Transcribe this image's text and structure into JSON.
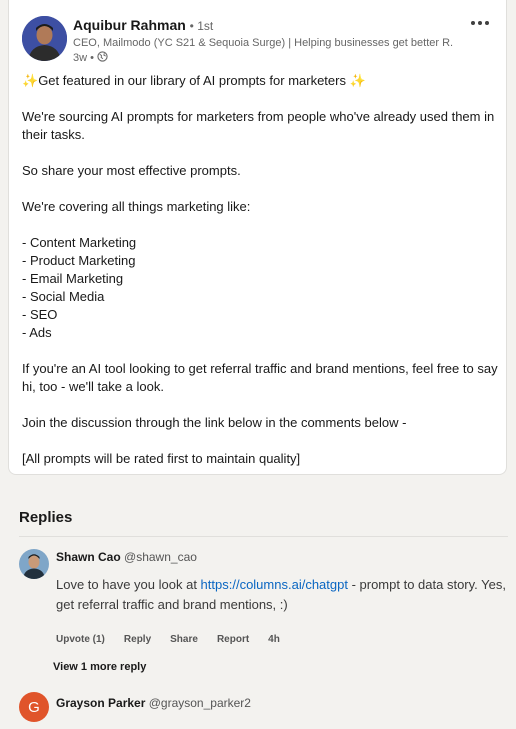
{
  "post": {
    "author_name": "Aquibur Rahman",
    "author_degree": "• 1st",
    "author_headline": "CEO, Mailmodo (YC S21 & Sequoia Surge) | Helping businesses get better R...",
    "post_age": "3w •",
    "intro": "Get featured in our library of AI prompts for marketers",
    "sourcing": "We're sourcing AI prompts for marketers from people who've already used them in their tasks.",
    "share": "So share your most effective prompts.",
    "covering": "We're covering all things marketing like:",
    "topics": [
      "- Content Marketing",
      "- Product Marketing",
      "- Email Marketing",
      "- Social Media",
      "- SEO",
      "- Ads"
    ],
    "ai_tool": "If you're an AI tool looking to get referral traffic and brand mentions, feel free to say hi, too -  we'll take a look.",
    "join": "Join the discussion through the link below in the comments below -",
    "rated": "[All prompts will be rated first to maintain quality]"
  },
  "replies": {
    "title": "Replies",
    "items": [
      {
        "name": "Shawn Cao",
        "handle": "@shawn_cao",
        "text_before": "Love to have you look at ",
        "link": "https://columns.ai/chatgpt",
        "text_after": " - prompt to data story. Yes, get referral traffic and brand mentions, :)",
        "upvote": "Upvote (1)",
        "reply": "Reply",
        "share": "Share",
        "report": "Report",
        "time": "4h"
      },
      {
        "name": "Grayson Parker",
        "handle": "@grayson_parker2",
        "avatar_letter": "G"
      }
    ],
    "view_more": "View 1 more reply"
  },
  "icons": {
    "sparkle": "sparkle-icon",
    "globe": "globe-icon",
    "more": "more-horizontal-icon"
  },
  "colors": {
    "link": "#0a66c2",
    "avatar_g": "#e0542a"
  }
}
